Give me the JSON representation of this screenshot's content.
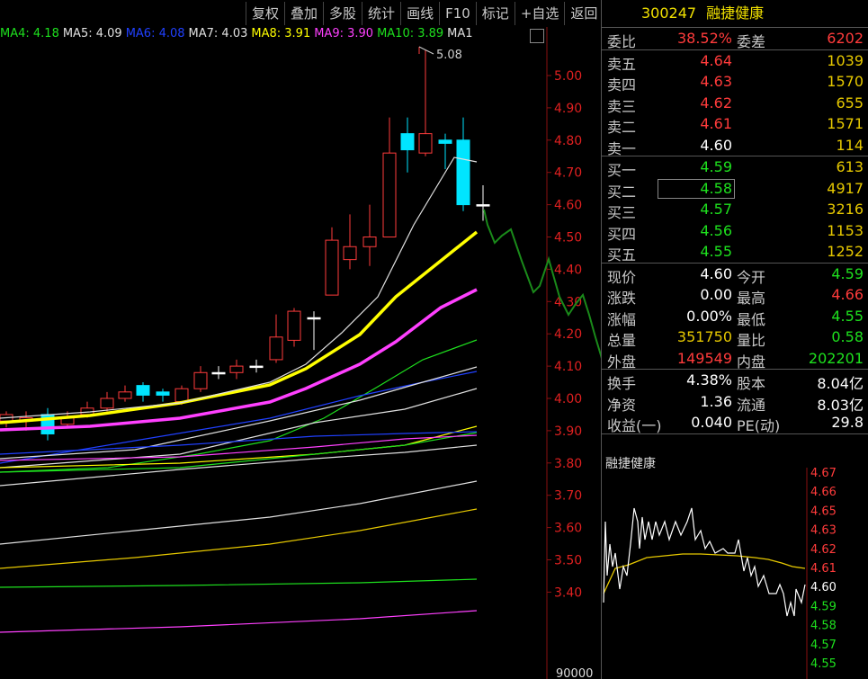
{
  "toolbar": [
    "复权",
    "叠加",
    "多股",
    "统计",
    "画线",
    "F10",
    "标记",
    "+自选",
    "返回"
  ],
  "ma": [
    {
      "label": "MA4:",
      "val": "4.18",
      "color": "#1ee01e"
    },
    {
      "label": "MA5:",
      "val": "4.09",
      "color": "#e0e0e0"
    },
    {
      "label": "MA6:",
      "val": "4.08",
      "color": "#2040ff"
    },
    {
      "label": "MA7:",
      "val": "4.03",
      "color": "#e0e0e0"
    },
    {
      "label": "MA8:",
      "val": "3.91",
      "color": "#ffff00"
    },
    {
      "label": "MA9:",
      "val": "3.90",
      "color": "#ff40ff"
    },
    {
      "label": "MA10:",
      "val": "3.89",
      "color": "#1ee01e"
    },
    {
      "label": "MA1",
      "val": "",
      "color": "#e0e0e0"
    }
  ],
  "high_marker": "5.08",
  "price_axis": [
    "5.00",
    "4.90",
    "4.80",
    "4.70",
    "4.60",
    "4.50",
    "4.40",
    "4.30",
    "4.20",
    "4.10",
    "4.00",
    "3.90",
    "3.80",
    "3.70",
    "3.60",
    "3.50",
    "3.40"
  ],
  "volume_label": "90000",
  "stock": {
    "code": "300247",
    "name": "融捷健康"
  },
  "wei": {
    "label1": "委比",
    "v1": "38.52%",
    "label2": "委差",
    "v2": "6202"
  },
  "asks": [
    {
      "label": "卖五",
      "price": "4.64",
      "vol": "1039"
    },
    {
      "label": "卖四",
      "price": "4.63",
      "vol": "1570"
    },
    {
      "label": "卖三",
      "price": "4.62",
      "vol": "655"
    },
    {
      "label": "卖二",
      "price": "4.61",
      "vol": "1571"
    },
    {
      "label": "卖一",
      "price": "4.60",
      "vol": "114"
    }
  ],
  "bids": [
    {
      "label": "买一",
      "price": "4.59",
      "vol": "613"
    },
    {
      "label": "买二",
      "price": "4.58",
      "vol": "4917"
    },
    {
      "label": "买三",
      "price": "4.57",
      "vol": "3216"
    },
    {
      "label": "买四",
      "price": "4.56",
      "vol": "1153"
    },
    {
      "label": "买五",
      "price": "4.55",
      "vol": "1252"
    }
  ],
  "quote": [
    {
      "l1": "现价",
      "v1": "4.60",
      "c1": "white",
      "l2": "今开",
      "v2": "4.59",
      "c2": "green"
    },
    {
      "l1": "涨跌",
      "v1": "0.00",
      "c1": "white",
      "l2": "最高",
      "v2": "4.66",
      "c2": "red"
    },
    {
      "l1": "涨幅",
      "v1": "0.00%",
      "c1": "white",
      "l2": "最低",
      "v2": "4.55",
      "c2": "green"
    },
    {
      "l1": "总量",
      "v1": "351750",
      "c1": "yellow",
      "l2": "量比",
      "v2": "0.58",
      "c2": "green"
    },
    {
      "l1": "外盘",
      "v1": "149549",
      "c1": "red",
      "l2": "内盘",
      "v2": "202201",
      "c2": "green"
    }
  ],
  "fund": [
    {
      "l1": "换手",
      "v1": "4.38%",
      "l2": "股本",
      "v2": "8.04亿"
    },
    {
      "l1": "净资",
      "v1": "1.36",
      "l2": "流通",
      "v2": "8.03亿"
    },
    {
      "l1": "收益(一)",
      "v1": "0.040",
      "l2": "PE(动)",
      "v2": "29.8"
    }
  ],
  "mini": {
    "title": "融捷健康",
    "axis": [
      "4.67",
      "4.66",
      "4.65",
      "4.63",
      "4.62",
      "4.61",
      "4.60",
      "4.59",
      "4.58",
      "4.57",
      "4.55"
    ],
    "axis_colors": [
      "#ff3b3b",
      "#ff3b3b",
      "#ff3b3b",
      "#ff3b3b",
      "#ff3b3b",
      "#ff3b3b",
      "#ffffff",
      "#1ee01e",
      "#1ee01e",
      "#1ee01e",
      "#1ee01e"
    ]
  },
  "colors": {
    "up": "#ff3b3b",
    "down": "#00e5ff",
    "panel_border": "#555555"
  }
}
